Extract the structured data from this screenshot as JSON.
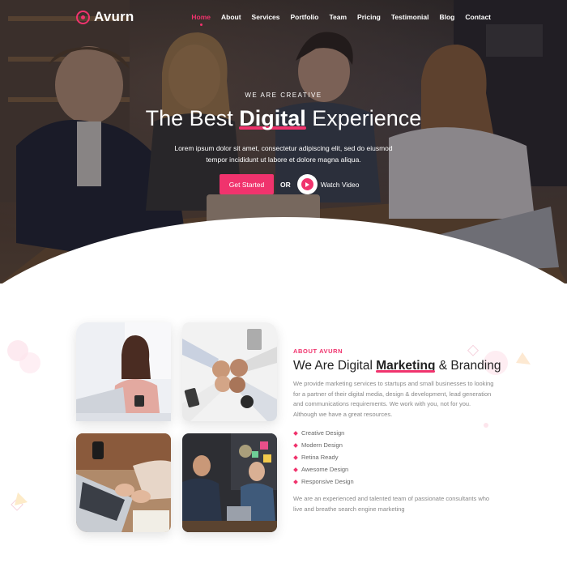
{
  "nav": {
    "brand": "Avurn",
    "items": [
      {
        "label": "Home",
        "active": true
      },
      {
        "label": "About"
      },
      {
        "label": "Services"
      },
      {
        "label": "Portfolio"
      },
      {
        "label": "Team"
      },
      {
        "label": "Pricing"
      },
      {
        "label": "Testimonial"
      },
      {
        "label": "Blog"
      },
      {
        "label": "Contact"
      }
    ]
  },
  "hero": {
    "eyebrow": "WE ARE CREATIVE",
    "title_pre": "The Best ",
    "title_highlight": "Digital",
    "title_post": " Experience",
    "subtext": "Lorem ipsum dolor sit amet, consectetur adipiscing elit, sed do eiusmod tempor incididunt ut labore et dolore magna aliqua.",
    "cta_label": "Get Started",
    "or_label": "OR",
    "video_label": "Watch Video"
  },
  "about": {
    "eyebrow": "ABOUT AVURN",
    "title_pre": "We Are Digital ",
    "title_highlight": "Marketing",
    "title_post": " & Branding",
    "body": "We provide marketing services to startups and small businesses to looking for a partner of their digital media, design & development, lead generation and communications requirements. We work with you, not for you. Although we have a great resources.",
    "features": [
      "Creative Design",
      "Modern Design",
      "Retina Ready",
      "Awesome Design",
      "Responsive Design"
    ],
    "footer": "We are an experienced and talented team of passionate consultants who live and breathe search engine marketing"
  },
  "colors": {
    "accent": "#f0336d"
  }
}
